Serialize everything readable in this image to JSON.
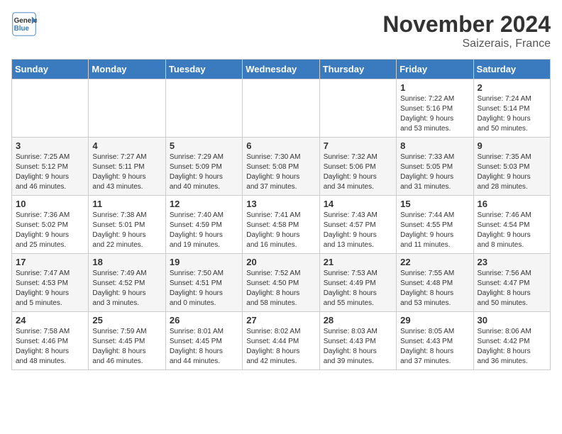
{
  "header": {
    "logo_line1": "General",
    "logo_line2": "Blue",
    "month": "November 2024",
    "location": "Saizerais, France"
  },
  "days_of_week": [
    "Sunday",
    "Monday",
    "Tuesday",
    "Wednesday",
    "Thursday",
    "Friday",
    "Saturday"
  ],
  "weeks": [
    {
      "days": [
        {
          "number": "",
          "info": ""
        },
        {
          "number": "",
          "info": ""
        },
        {
          "number": "",
          "info": ""
        },
        {
          "number": "",
          "info": ""
        },
        {
          "number": "",
          "info": ""
        },
        {
          "number": "1",
          "info": "Sunrise: 7:22 AM\nSunset: 5:16 PM\nDaylight: 9 hours\nand 53 minutes."
        },
        {
          "number": "2",
          "info": "Sunrise: 7:24 AM\nSunset: 5:14 PM\nDaylight: 9 hours\nand 50 minutes."
        }
      ]
    },
    {
      "days": [
        {
          "number": "3",
          "info": "Sunrise: 7:25 AM\nSunset: 5:12 PM\nDaylight: 9 hours\nand 46 minutes."
        },
        {
          "number": "4",
          "info": "Sunrise: 7:27 AM\nSunset: 5:11 PM\nDaylight: 9 hours\nand 43 minutes."
        },
        {
          "number": "5",
          "info": "Sunrise: 7:29 AM\nSunset: 5:09 PM\nDaylight: 9 hours\nand 40 minutes."
        },
        {
          "number": "6",
          "info": "Sunrise: 7:30 AM\nSunset: 5:08 PM\nDaylight: 9 hours\nand 37 minutes."
        },
        {
          "number": "7",
          "info": "Sunrise: 7:32 AM\nSunset: 5:06 PM\nDaylight: 9 hours\nand 34 minutes."
        },
        {
          "number": "8",
          "info": "Sunrise: 7:33 AM\nSunset: 5:05 PM\nDaylight: 9 hours\nand 31 minutes."
        },
        {
          "number": "9",
          "info": "Sunrise: 7:35 AM\nSunset: 5:03 PM\nDaylight: 9 hours\nand 28 minutes."
        }
      ]
    },
    {
      "days": [
        {
          "number": "10",
          "info": "Sunrise: 7:36 AM\nSunset: 5:02 PM\nDaylight: 9 hours\nand 25 minutes."
        },
        {
          "number": "11",
          "info": "Sunrise: 7:38 AM\nSunset: 5:01 PM\nDaylight: 9 hours\nand 22 minutes."
        },
        {
          "number": "12",
          "info": "Sunrise: 7:40 AM\nSunset: 4:59 PM\nDaylight: 9 hours\nand 19 minutes."
        },
        {
          "number": "13",
          "info": "Sunrise: 7:41 AM\nSunset: 4:58 PM\nDaylight: 9 hours\nand 16 minutes."
        },
        {
          "number": "14",
          "info": "Sunrise: 7:43 AM\nSunset: 4:57 PM\nDaylight: 9 hours\nand 13 minutes."
        },
        {
          "number": "15",
          "info": "Sunrise: 7:44 AM\nSunset: 4:55 PM\nDaylight: 9 hours\nand 11 minutes."
        },
        {
          "number": "16",
          "info": "Sunrise: 7:46 AM\nSunset: 4:54 PM\nDaylight: 9 hours\nand 8 minutes."
        }
      ]
    },
    {
      "days": [
        {
          "number": "17",
          "info": "Sunrise: 7:47 AM\nSunset: 4:53 PM\nDaylight: 9 hours\nand 5 minutes."
        },
        {
          "number": "18",
          "info": "Sunrise: 7:49 AM\nSunset: 4:52 PM\nDaylight: 9 hours\nand 3 minutes."
        },
        {
          "number": "19",
          "info": "Sunrise: 7:50 AM\nSunset: 4:51 PM\nDaylight: 9 hours\nand 0 minutes."
        },
        {
          "number": "20",
          "info": "Sunrise: 7:52 AM\nSunset: 4:50 PM\nDaylight: 8 hours\nand 58 minutes."
        },
        {
          "number": "21",
          "info": "Sunrise: 7:53 AM\nSunset: 4:49 PM\nDaylight: 8 hours\nand 55 minutes."
        },
        {
          "number": "22",
          "info": "Sunrise: 7:55 AM\nSunset: 4:48 PM\nDaylight: 8 hours\nand 53 minutes."
        },
        {
          "number": "23",
          "info": "Sunrise: 7:56 AM\nSunset: 4:47 PM\nDaylight: 8 hours\nand 50 minutes."
        }
      ]
    },
    {
      "days": [
        {
          "number": "24",
          "info": "Sunrise: 7:58 AM\nSunset: 4:46 PM\nDaylight: 8 hours\nand 48 minutes."
        },
        {
          "number": "25",
          "info": "Sunrise: 7:59 AM\nSunset: 4:45 PM\nDaylight: 8 hours\nand 46 minutes."
        },
        {
          "number": "26",
          "info": "Sunrise: 8:01 AM\nSunset: 4:45 PM\nDaylight: 8 hours\nand 44 minutes."
        },
        {
          "number": "27",
          "info": "Sunrise: 8:02 AM\nSunset: 4:44 PM\nDaylight: 8 hours\nand 42 minutes."
        },
        {
          "number": "28",
          "info": "Sunrise: 8:03 AM\nSunset: 4:43 PM\nDaylight: 8 hours\nand 39 minutes."
        },
        {
          "number": "29",
          "info": "Sunrise: 8:05 AM\nSunset: 4:43 PM\nDaylight: 8 hours\nand 37 minutes."
        },
        {
          "number": "30",
          "info": "Sunrise: 8:06 AM\nSunset: 4:42 PM\nDaylight: 8 hours\nand 36 minutes."
        }
      ]
    }
  ]
}
